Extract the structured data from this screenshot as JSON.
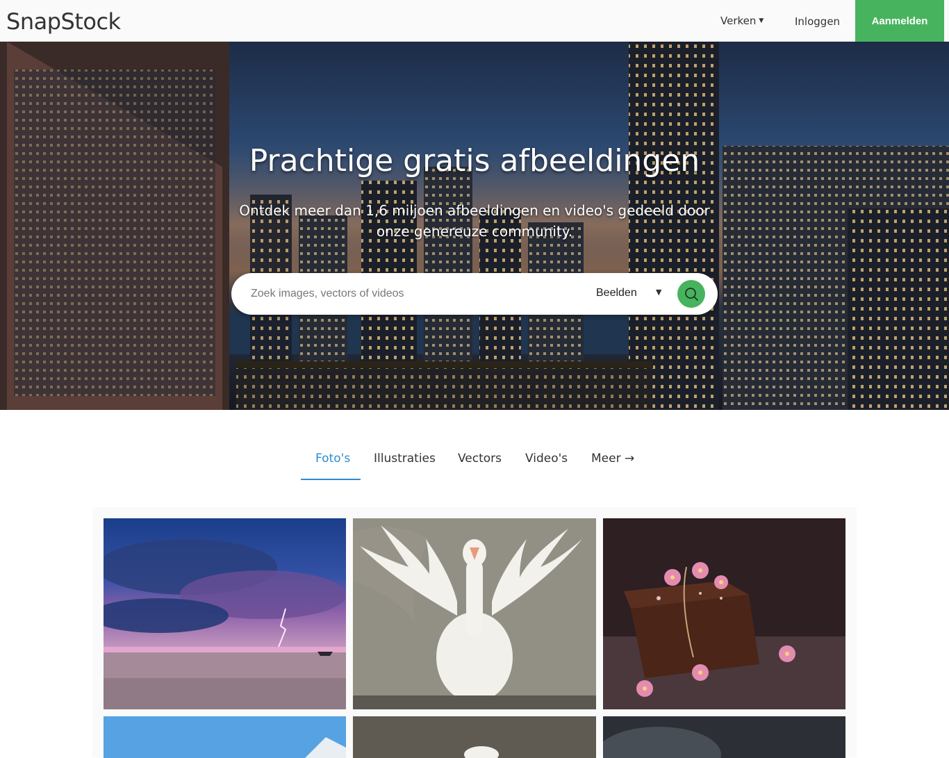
{
  "brand": {
    "logo": "SnapStock"
  },
  "nav": {
    "explore_label": "Verken",
    "login_label": "Inloggen",
    "signup_label": "Aanmelden"
  },
  "hero": {
    "title": "Prachtige gratis afbeeldingen",
    "subtitle": "Ontdek meer dan 1,6 miljoen afbeeldingen en video's gedeeld door onze genereuze community."
  },
  "search": {
    "placeholder": "Zoek images, vectors of videos",
    "value": "",
    "type_selected": "Beelden"
  },
  "tabs": [
    {
      "label": "Foto's",
      "active": true
    },
    {
      "label": "Illustraties",
      "active": false
    },
    {
      "label": "Vectors",
      "active": false
    },
    {
      "label": "Video's",
      "active": false
    },
    {
      "label": "Meer →",
      "active": false
    }
  ],
  "gallery": {
    "items": [
      {
        "subject": "stormy-beach-lightning"
      },
      {
        "subject": "white-goose-spreading-wings"
      },
      {
        "subject": "chocolate-cake-with-flowers"
      },
      {
        "subject": "mountain-blue-sky"
      },
      {
        "subject": "goose-water-splash"
      },
      {
        "subject": "dark-moonlit-sky"
      }
    ]
  },
  "colors": {
    "accent_green": "#48b35e",
    "tab_active_blue": "#2a8cd6"
  }
}
